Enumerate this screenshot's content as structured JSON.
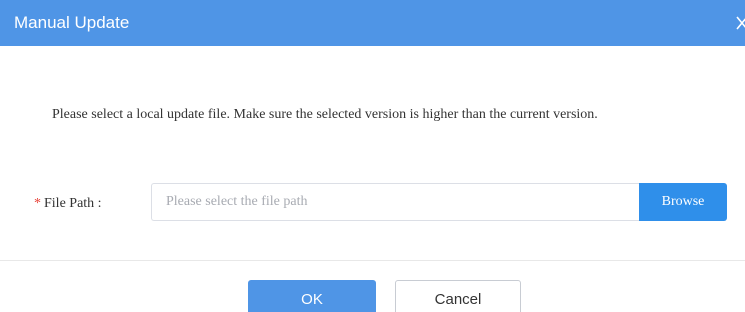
{
  "dialog": {
    "title": "Manual Update",
    "close_icon": "close-icon",
    "message": "Please select a local update file. Make sure the selected version is higher than the current version.",
    "file_path": {
      "required_marker": "*",
      "label": "File Path :",
      "value": "",
      "placeholder": "Please select the file path",
      "browse_label": "Browse"
    },
    "buttons": {
      "ok_label": "OK",
      "cancel_label": "Cancel"
    }
  },
  "colors": {
    "title_bar": "#4f95e6",
    "primary": "#2f8fea",
    "required": "#e8443a"
  }
}
